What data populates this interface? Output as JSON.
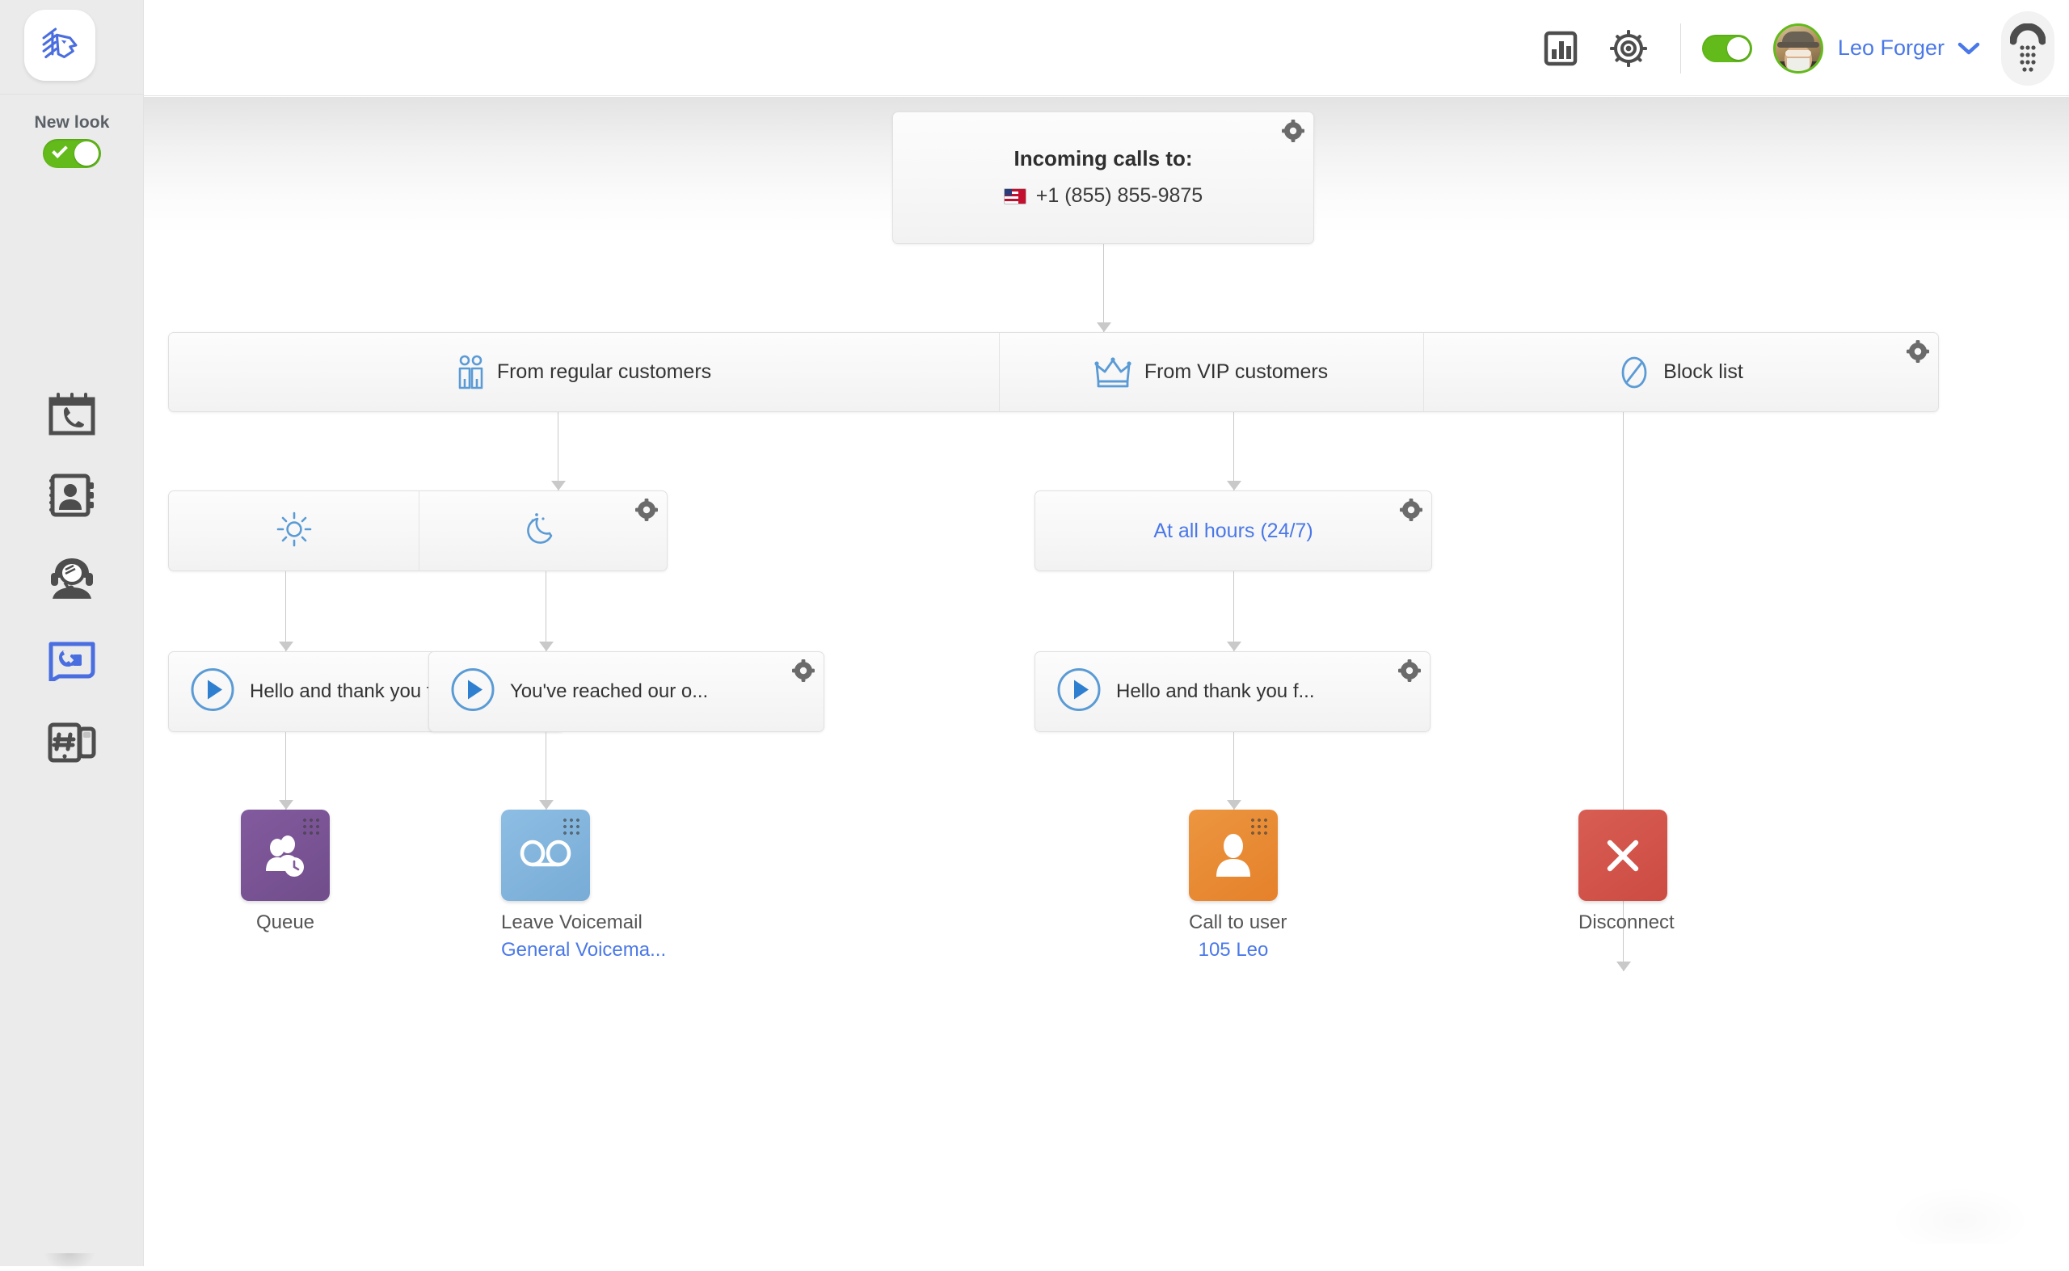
{
  "sidebar": {
    "brand_logo": "lion-logo",
    "new_look": {
      "label": "New look",
      "enabled": true
    },
    "items": [
      {
        "name": "call-history",
        "icon": "calendar-phone-icon"
      },
      {
        "name": "contacts",
        "icon": "address-book-icon"
      },
      {
        "name": "agents",
        "icon": "headset-agent-icon"
      },
      {
        "name": "call-flows",
        "icon": "call-flow-icon",
        "active": true
      },
      {
        "name": "numbers",
        "icon": "hash-device-icon"
      }
    ]
  },
  "header": {
    "analytics_icon": "bar-chart-icon",
    "settings_icon": "gear-wheel-icon",
    "status_toggle": {
      "name": "availability-toggle",
      "enabled": true
    },
    "user": {
      "name": "Leo Forger",
      "avatar": "user-avatar",
      "caret": "chevron-down-icon"
    },
    "dialpad_icon": "dialpad-handset-icon"
  },
  "flow": {
    "root": {
      "title": "Incoming calls to:",
      "number": "+1 (855) 855-9875",
      "flag": "us-ca-flag",
      "gear": "gear-icon"
    },
    "filters": [
      {
        "label": "From regular customers",
        "icon": "two-people-icon"
      },
      {
        "label": "From VIP customers",
        "icon": "crown-icon"
      },
      {
        "label": "Block list",
        "icon": "no-entry-icon",
        "gear": "gear-icon"
      }
    ],
    "schedule_left": {
      "gear": "gear-icon",
      "segments": [
        {
          "label": "",
          "icon": "sun-icon"
        },
        {
          "label": "",
          "icon": "moon-icon"
        }
      ]
    },
    "schedule_right": {
      "gear": "gear-icon",
      "label": "At all hours (24/7)"
    },
    "greetings": [
      {
        "text": "Hello and thank you f...",
        "play": "play-icon",
        "gear": "gear-icon"
      },
      {
        "text": "You've reached our o...",
        "play": "play-icon",
        "gear": "gear-icon"
      },
      {
        "text": "Hello and thank you f...",
        "play": "play-icon",
        "gear": "gear-icon"
      }
    ],
    "actions": [
      {
        "label": "Queue",
        "sub": "",
        "icon": "queue-people-clock-icon",
        "color": "#7c5797"
      },
      {
        "label": "Leave Voicemail",
        "sub": "General Voicema...",
        "icon": "voicemail-icon",
        "color": "#83b6de"
      },
      {
        "label": "Call to user",
        "sub": "105 Leo",
        "icon": "user-silhouette-icon",
        "color": "#e88b32"
      },
      {
        "label": "Disconnect",
        "sub": "",
        "icon": "close-x-icon",
        "color": "#d2524a"
      }
    ]
  },
  "colors": {
    "accent_blue": "#4a78e8",
    "icon_blue": "#5b9bd5",
    "toggle_green": "#62bb1a",
    "queue_purple": "#7c5797",
    "voicemail_blue": "#83b6de",
    "call_orange": "#e88b32",
    "disconnect_red": "#d2524a"
  }
}
